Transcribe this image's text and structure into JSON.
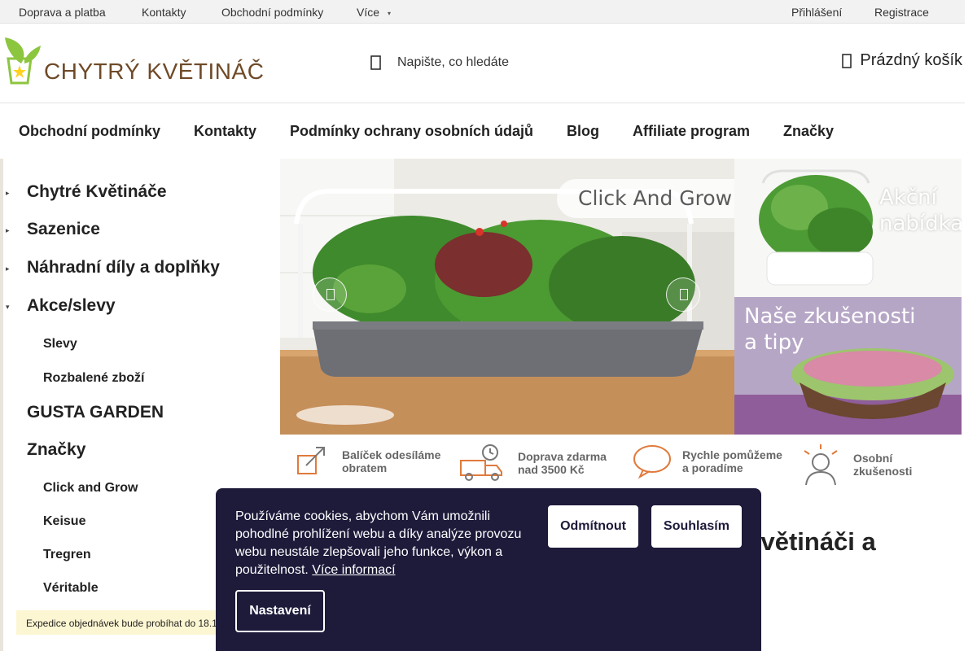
{
  "topbar": {
    "links": [
      "Doprava a platba",
      "Kontakty",
      "Obchodní podmínky",
      "Více"
    ],
    "login": "Přihlášení",
    "register": "Registrace"
  },
  "header": {
    "logo_text": "CHYTRÝ KVĚTINÁČ",
    "search_placeholder": "Napište, co hledáte",
    "cart_label": "Prázdný košík"
  },
  "mainnav": [
    "Obchodní podmínky",
    "Kontakty",
    "Podmínky ochrany osobních údajů",
    "Blog",
    "Affiliate program",
    "Značky"
  ],
  "sidebar": {
    "categories": [
      "Chytré Květináče",
      "Sazenice",
      "Náhradní díly a doplňky",
      "Akce/slevy"
    ],
    "akce_sub": [
      "Slevy",
      "Rozbalené zboží"
    ],
    "gusta": "GUSTA GARDEN",
    "brands": "Značky",
    "brand_sub": [
      "Click and Grow",
      "Keisue",
      "Tregren",
      "Véritable"
    ]
  },
  "hero": {
    "slide_caption": "Click And Grow >",
    "banner1": [
      "Akční",
      "nabídka"
    ],
    "banner2": [
      "Naše zkušenosti",
      "a tipy"
    ]
  },
  "benefits": [
    [
      "Balíček odesíláme",
      "obratem"
    ],
    [
      "Doprava zdarma",
      "nad 3500 Kč"
    ],
    [
      "Rychle pomůžeme",
      "a poradíme"
    ],
    [
      "Osobní",
      "zkušenosti"
    ]
  ],
  "page_heading": "i květináči a",
  "notice": "Expedice objednávek bude probíhat do 18.1",
  "cookie": {
    "text": "Používáme cookies, abychom Vám umožnili pohodlné prohlížení webu a díky analýze provozu webu neustále zlepšovali jeho funkce, výkon a použitelnost.",
    "link": "Více informací",
    "decline": "Odmítnout",
    "accept": "Souhlasím",
    "settings": "Nastavení"
  },
  "colors": {
    "logo_green": "#8cc63f",
    "logo_brown": "#6f4a28",
    "cookie_bg": "#1d1a3a",
    "notice_bg": "#fdf6d2"
  }
}
